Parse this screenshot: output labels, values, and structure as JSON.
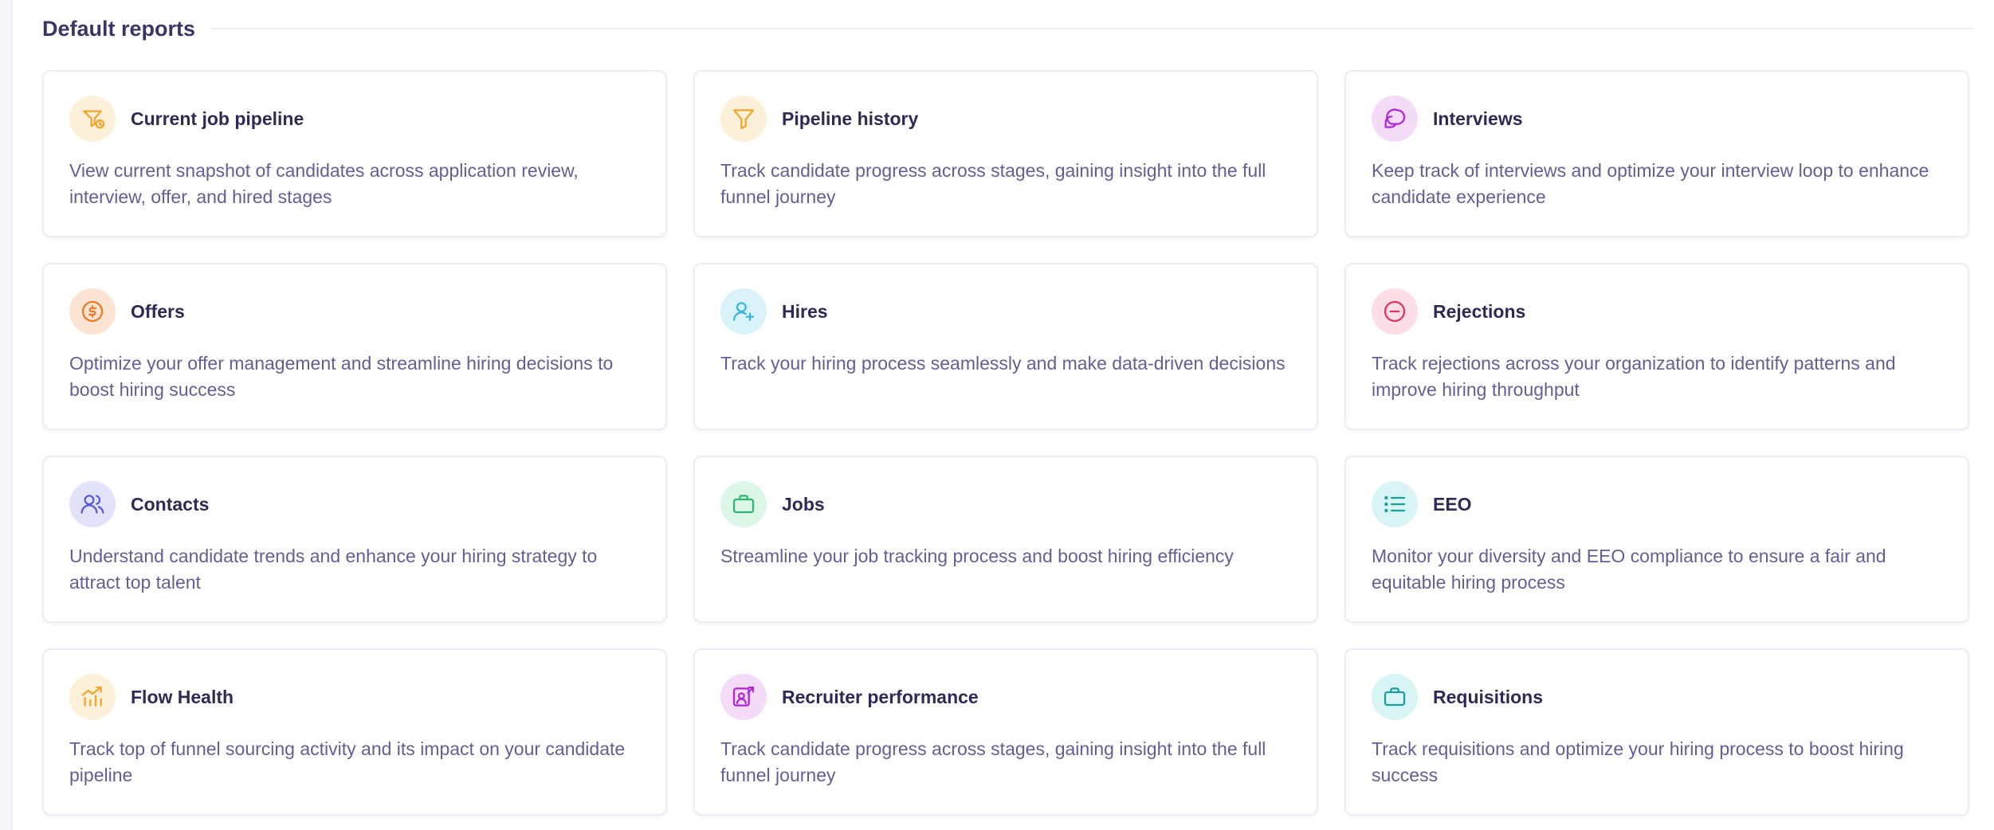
{
  "section": {
    "title": "Default reports"
  },
  "cards": [
    {
      "title": "Current job pipeline",
      "description": "View current snapshot of candidates across application review, interview, offer, and hired stages",
      "icon": "funnel-clock-icon",
      "bg": "#fdf0d8",
      "fg": "#f3a42b"
    },
    {
      "title": "Pipeline history",
      "description": "Track candidate progress across stages, gaining insight into the full funnel journey",
      "icon": "funnel-icon",
      "bg": "#fdf0d8",
      "fg": "#f3a42b"
    },
    {
      "title": "Interviews",
      "description": "Keep track of interviews and optimize your interview loop to enhance candidate experience",
      "icon": "chat-bubbles-icon",
      "bg": "#f4dcf9",
      "fg": "#b026d6"
    },
    {
      "title": "Offers",
      "description": "Optimize your offer management and streamline hiring decisions to boost hiring success",
      "icon": "dollar-coin-icon",
      "bg": "#fde4d2",
      "fg": "#ef7a26"
    },
    {
      "title": "Hires",
      "description": "Track your hiring process seamlessly and make data-driven decisions",
      "icon": "user-plus-icon",
      "bg": "#daf3fb",
      "fg": "#36b6dc"
    },
    {
      "title": "Rejections",
      "description": "Track rejections across your organization to identify patterns and improve hiring throughput",
      "icon": "minus-circle-icon",
      "bg": "#fddde6",
      "fg": "#e0335f"
    },
    {
      "title": "Contacts",
      "description": "Understand candidate trends and enhance your hiring strategy to attract top talent",
      "icon": "users-icon",
      "bg": "#e2e2fb",
      "fg": "#5a5ad6"
    },
    {
      "title": "Jobs",
      "description": "Streamline your job tracking process and boost hiring efficiency",
      "icon": "briefcase-icon",
      "bg": "#dcf6e8",
      "fg": "#2cb674"
    },
    {
      "title": "EEO",
      "description": "Monitor your diversity and EEO compliance to ensure a fair and equitable hiring process",
      "icon": "list-icon",
      "bg": "#d9f4f4",
      "fg": "#1b9e9e"
    },
    {
      "title": "Flow Health",
      "description": "Track top of funnel sourcing activity and its impact on your candidate pipeline",
      "icon": "bar-chart-trend-icon",
      "bg": "#fdf0d8",
      "fg": "#f3a42b"
    },
    {
      "title": "Recruiter performance",
      "description": "Track candidate progress across stages, gaining insight into the full funnel journey",
      "icon": "user-chart-icon",
      "bg": "#f4dcf9",
      "fg": "#b026d6"
    },
    {
      "title": "Requisitions",
      "description": "Track requisitions and optimize your hiring process to boost hiring success",
      "icon": "briefcase-icon",
      "bg": "#d9f4f4",
      "fg": "#1b9e9e"
    }
  ]
}
